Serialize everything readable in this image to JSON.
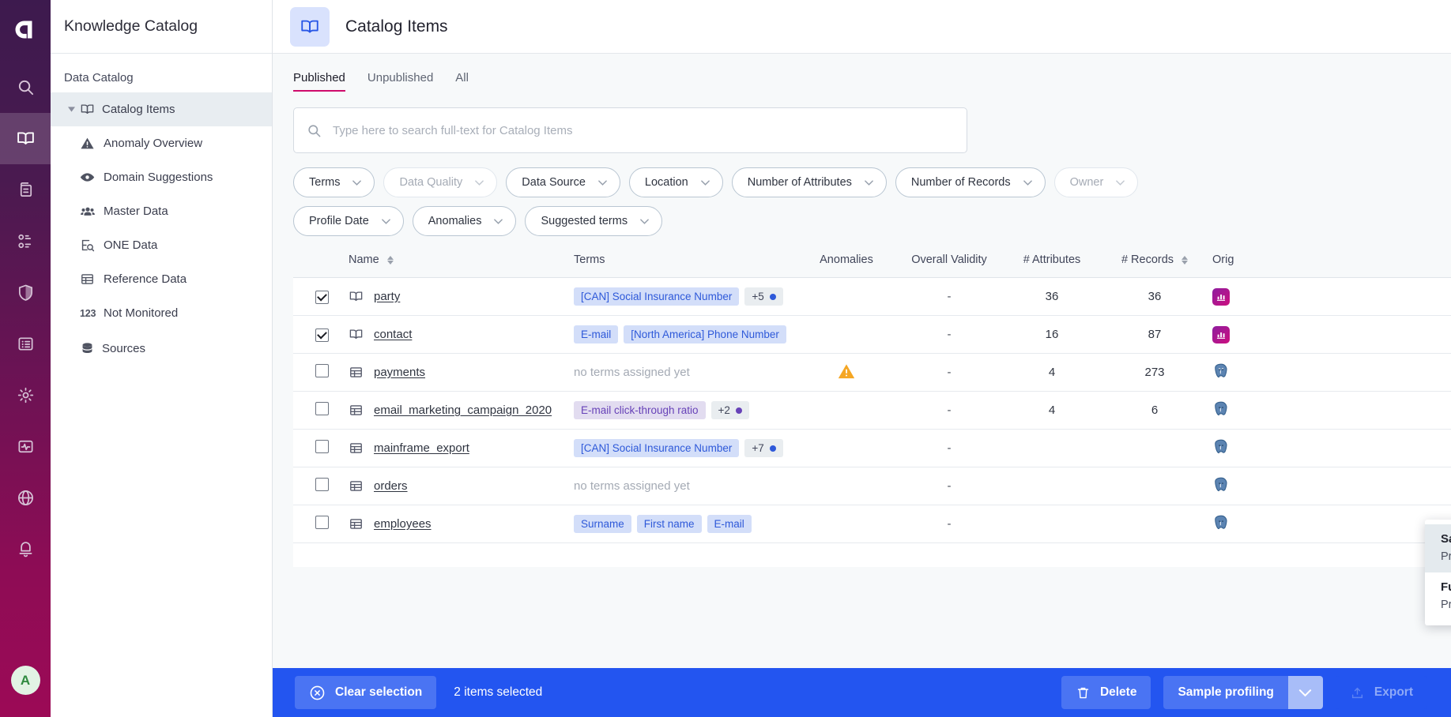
{
  "rail": {
    "logo_name": "ataccama-logo",
    "items": [
      {
        "name": "search-icon",
        "label": "Search",
        "active": false
      },
      {
        "name": "book-icon",
        "label": "Knowledge Catalog",
        "active": true
      },
      {
        "name": "clipboard-icon",
        "label": "Documents",
        "active": false
      },
      {
        "name": "model-icon",
        "label": "Data Model",
        "active": false
      },
      {
        "name": "shield-icon",
        "label": "Governance",
        "active": false
      },
      {
        "name": "list-icon",
        "label": "Tasks",
        "active": false
      },
      {
        "name": "gear-icon",
        "label": "Settings",
        "active": false
      },
      {
        "name": "monitoring-icon",
        "label": "Monitoring",
        "active": false
      },
      {
        "name": "globe-icon",
        "label": "Global",
        "active": false
      },
      {
        "name": "bell-icon",
        "label": "Notifications",
        "active": false
      }
    ],
    "avatar_initial": "A"
  },
  "nav": {
    "title": "Knowledge Catalog",
    "section_label": "Data Catalog",
    "items": [
      {
        "label": "Catalog Items",
        "icon": "book-icon",
        "selected": true,
        "child": false,
        "caret": true
      },
      {
        "label": "Anomaly Overview",
        "icon": "warning-triangle-icon",
        "selected": false,
        "child": true
      },
      {
        "label": "Domain Suggestions",
        "icon": "eye-icon",
        "selected": false,
        "child": true
      },
      {
        "label": "Master Data",
        "icon": "people-icon",
        "selected": false,
        "child": true
      },
      {
        "label": "ONE Data",
        "icon": "data-search-icon",
        "selected": false,
        "child": true
      },
      {
        "label": "Reference Data",
        "icon": "table-icon",
        "selected": false,
        "child": true
      },
      {
        "label": "Not Monitored",
        "icon": "numbers-123-icon",
        "selected": false,
        "child": true
      },
      {
        "label": "Sources",
        "icon": "database-icon",
        "selected": false,
        "child": false
      }
    ]
  },
  "topbar": {
    "icon": "book-icon",
    "title": "Catalog Items",
    "kebab": "more-options-icon"
  },
  "tabs": [
    {
      "label": "Published",
      "active": true
    },
    {
      "label": "Unpublished",
      "active": false
    },
    {
      "label": "All",
      "active": false
    }
  ],
  "search": {
    "placeholder": "Type here to search full-text for Catalog Items",
    "value": "",
    "icon": "search-icon"
  },
  "filters": [
    {
      "label": "Terms",
      "muted": false
    },
    {
      "label": "Data Quality",
      "muted": true
    },
    {
      "label": "Data Source",
      "muted": false
    },
    {
      "label": "Location",
      "muted": false
    },
    {
      "label": "Number of Attributes",
      "muted": false
    },
    {
      "label": "Number of Records",
      "muted": false
    },
    {
      "label": "Owner",
      "muted": true
    },
    {
      "label": "Profile Date",
      "muted": false
    },
    {
      "label": "Anomalies",
      "muted": false
    },
    {
      "label": "Suggested terms",
      "muted": false
    }
  ],
  "table": {
    "columns": [
      {
        "label": "Name",
        "sortable": true
      },
      {
        "label": "Terms",
        "sortable": false
      },
      {
        "label": "Anomalies",
        "sortable": false
      },
      {
        "label": "Overall Validity",
        "sortable": false
      },
      {
        "label": "# Attributes",
        "sortable": false
      },
      {
        "label": "# Records",
        "sortable": true
      },
      {
        "label": "Orig",
        "sortable": false
      }
    ],
    "rows": [
      {
        "selected": true,
        "icon": "book-icon",
        "name": "party",
        "terms": [
          {
            "text": "[CAN] Social Insurance Number",
            "style": "blue"
          }
        ],
        "more": {
          "text": "+5",
          "dot": "blue"
        },
        "no_terms": false,
        "anomaly": false,
        "overall_validity": "-",
        "attributes": "36",
        "records": "36",
        "origin": "chart-badge-icon"
      },
      {
        "selected": true,
        "icon": "book-icon",
        "name": "contact",
        "terms": [
          {
            "text": "E-mail",
            "style": "blue"
          },
          {
            "text": "[North America] Phone Number",
            "style": "blue"
          }
        ],
        "more": null,
        "no_terms": false,
        "anomaly": false,
        "overall_validity": "-",
        "attributes": "16",
        "records": "87",
        "origin": "chart-badge-icon"
      },
      {
        "selected": false,
        "icon": "table-icon",
        "name": "payments",
        "terms": [],
        "more": null,
        "no_terms": true,
        "no_terms_text": "no terms assigned yet",
        "anomaly": true,
        "overall_validity": "-",
        "attributes": "4",
        "records": "273",
        "origin": "postgresql-icon"
      },
      {
        "selected": false,
        "icon": "table-icon",
        "name": "email_marketing_campaign_2020",
        "terms": [
          {
            "text": "E-mail click-through ratio",
            "style": "purple"
          }
        ],
        "more": {
          "text": "+2",
          "dot": "purple"
        },
        "no_terms": false,
        "anomaly": false,
        "overall_validity": "-",
        "attributes": "4",
        "records": "6",
        "origin": "postgresql-icon"
      },
      {
        "selected": false,
        "icon": "table-icon",
        "name": "mainframe_export",
        "terms": [
          {
            "text": "[CAN] Social Insurance Number",
            "style": "blue"
          }
        ],
        "more": {
          "text": "+7",
          "dot": "blue"
        },
        "no_terms": false,
        "anomaly": false,
        "overall_validity": "-",
        "attributes": "",
        "records": "",
        "origin": "postgresql-icon"
      },
      {
        "selected": false,
        "icon": "table-icon",
        "name": "orders",
        "terms": [],
        "more": null,
        "no_terms": true,
        "no_terms_text": "no terms assigned yet",
        "anomaly": false,
        "overall_validity": "-",
        "attributes": "",
        "records": "",
        "origin": "postgresql-icon"
      },
      {
        "selected": false,
        "icon": "table-icon",
        "name": "employees",
        "terms": [
          {
            "text": "Surname",
            "style": "blue"
          },
          {
            "text": "First name",
            "style": "blue"
          },
          {
            "text": "E-mail",
            "style": "blue"
          }
        ],
        "more": null,
        "no_terms": false,
        "anomaly": false,
        "overall_validity": "-",
        "attributes": "",
        "records": "",
        "origin": "postgresql-icon"
      }
    ]
  },
  "dropdown": {
    "items": [
      {
        "title": "Sample profiling",
        "subtitle": "Profile a sample of the dataset",
        "highlighted": true
      },
      {
        "title": "Full profiling",
        "subtitle": "Profile the full dataset",
        "highlighted": false
      }
    ]
  },
  "actionbar": {
    "clear_label": "Clear selection",
    "clear_icon": "close-circle-icon",
    "selection_text": "2 items selected",
    "delete_label": "Delete",
    "delete_icon": "trash-icon",
    "profiling_label": "Sample profiling",
    "profiling_caret_icon": "chevron-down-icon",
    "export_label": "Export",
    "export_icon": "upload-icon"
  },
  "colors": {
    "accent_blue": "#2355f0",
    "tab_underline": "#cf0b6b",
    "rail_top": "#3d1a4e",
    "rail_bottom": "#9c0a56",
    "term_blue_bg": "#d3def9",
    "term_blue_fg": "#2e59d9",
    "term_purple_bg": "#e2dcf0",
    "term_purple_fg": "#6742b8",
    "warning": "#f5a623"
  }
}
